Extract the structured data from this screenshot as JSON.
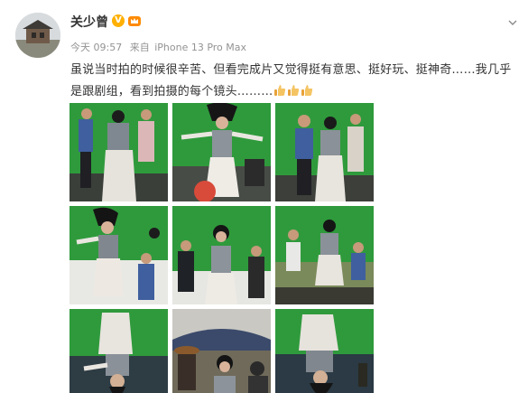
{
  "post": {
    "username": "关少曾",
    "verified_mark": "V",
    "time": "今天 09:57",
    "source_prefix": "来自",
    "source": "iPhone 13 Pro Max",
    "text": "虽说当时拍的时候很辛苦、但看完成片又觉得挺有意思、挺好玩、挺神奇……我几乎是跟剧组，看到拍摄的每个镜头………",
    "emoji": [
      "thumbs-up",
      "thumbs-up",
      "thumbs-up"
    ]
  },
  "icons": {
    "verified": "verified-v-icon",
    "member": "member-crown-icon",
    "menu": "chevron-down-icon"
  },
  "colors": {
    "name": "#333333",
    "meta": "#939393",
    "verified": "#ffb000",
    "green_screen": "#2f9a3c"
  },
  "photos": [
    "film-set-photo-1",
    "film-set-photo-2",
    "film-set-photo-3",
    "film-set-photo-4",
    "film-set-photo-5",
    "film-set-photo-6",
    "film-set-photo-7",
    "film-set-photo-8",
    "film-set-photo-9"
  ]
}
